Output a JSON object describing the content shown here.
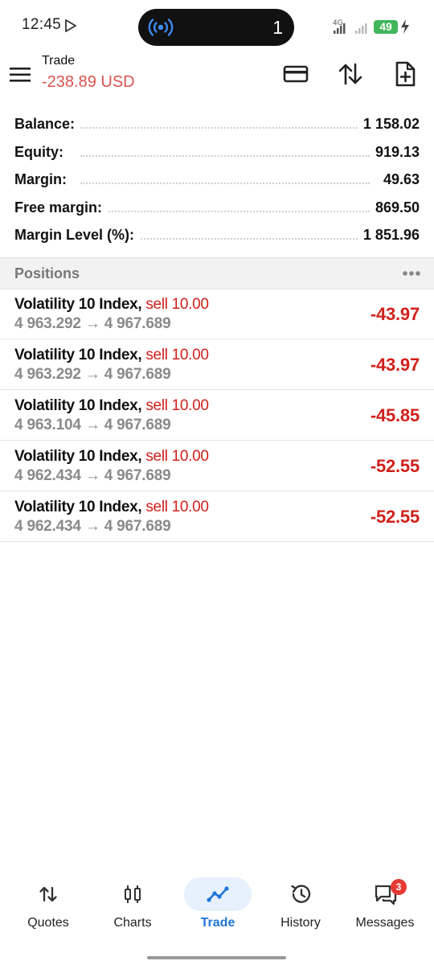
{
  "status_bar": {
    "time": "12:45",
    "island_count": "1",
    "network": "4G",
    "battery": "49"
  },
  "app_bar": {
    "title": "Trade",
    "subtitle": "-238.89 USD"
  },
  "account": [
    {
      "label": "Balance:",
      "value": "1 158.02"
    },
    {
      "label": "Equity:",
      "value": "919.13"
    },
    {
      "label": "Margin:",
      "value": "49.63"
    },
    {
      "label": "Free margin:",
      "value": "869.50"
    },
    {
      "label": "Margin Level (%):",
      "value": "1 851.96"
    }
  ],
  "positions": {
    "title": "Positions",
    "items": [
      {
        "symbol": "Volatility 10 Index,",
        "type": "sell 10.00",
        "open_price": "4 963.292",
        "arrow": "→",
        "current_price": "4 967.689",
        "profit": "-43.97"
      },
      {
        "symbol": "Volatility 10 Index,",
        "type": "sell 10.00",
        "open_price": "4 963.292",
        "arrow": "→",
        "current_price": "4 967.689",
        "profit": "-43.97"
      },
      {
        "symbol": "Volatility 10 Index,",
        "type": "sell 10.00",
        "open_price": "4 963.104",
        "arrow": "→",
        "current_price": "4 967.689",
        "profit": "-45.85"
      },
      {
        "symbol": "Volatility 10 Index,",
        "type": "sell 10.00",
        "open_price": "4 962.434",
        "arrow": "→",
        "current_price": "4 967.689",
        "profit": "-52.55"
      },
      {
        "symbol": "Volatility 10 Index,",
        "type": "sell 10.00",
        "open_price": "4 962.434",
        "arrow": "→",
        "current_price": "4 967.689",
        "profit": "-52.55"
      }
    ]
  },
  "bottom_nav": {
    "items": [
      {
        "label": "Quotes",
        "icon": "quotes-icon"
      },
      {
        "label": "Charts",
        "icon": "candlestick-icon"
      },
      {
        "label": "Trade",
        "icon": "trade-icon"
      },
      {
        "label": "History",
        "icon": "history-icon"
      },
      {
        "label": "Messages",
        "icon": "messages-icon"
      }
    ],
    "active": "Trade",
    "messages_badge": "3"
  },
  "colors": {
    "loss": "#d0201b",
    "subtitle": "#d9534f",
    "active_tab": "#1f76d6",
    "battery": "#3fb65a"
  }
}
